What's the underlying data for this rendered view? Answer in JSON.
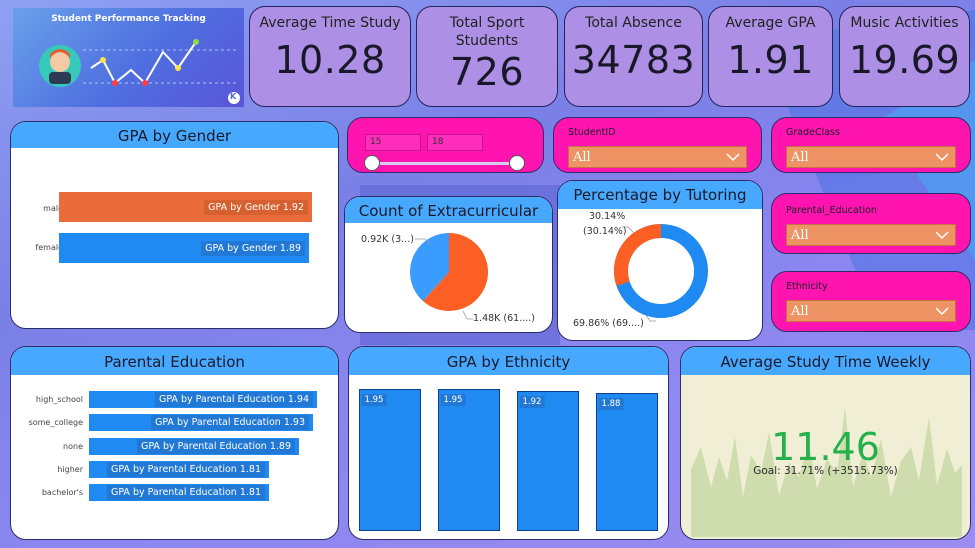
{
  "banner": {
    "title": "Student Performance Tracking",
    "logo_letter": "K"
  },
  "kpis": [
    {
      "label": "Average Time Study",
      "value": "10.28"
    },
    {
      "label": "Total Sport Students",
      "value": "726"
    },
    {
      "label": "Total Absence",
      "value": "34783"
    },
    {
      "label": "Average GPA",
      "value": "1.91"
    },
    {
      "label": "Music Activities",
      "value": "19.69"
    }
  ],
  "gpa_gender": {
    "title": "GPA by Gender",
    "rows": [
      {
        "category": "male",
        "label": "GPA by Gender 1.92",
        "value": 1.92,
        "color": "#ea6c3a"
      },
      {
        "category": "female",
        "label": "GPA by Gender 1.89",
        "value": 1.89,
        "color": "#1f8af2"
      }
    ]
  },
  "age_slider": {
    "min": "15",
    "max": "18"
  },
  "slicers": {
    "studentid": {
      "name": "StudentID",
      "value": "All"
    },
    "gradeclass": {
      "name": "GradeClass",
      "value": "All"
    },
    "parental_education": {
      "name": "Parental_Education",
      "value": "All"
    },
    "ethnicity": {
      "name": "Ethnicity",
      "value": "All"
    }
  },
  "extracurricular": {
    "title": "Count of Extracurricular",
    "label_small": "0.92K (3...)",
    "label_large": "1.48K (61....)"
  },
  "tutoring": {
    "title": "Percentage by Tutoring",
    "label_small_1": "30.14%",
    "label_small_2": "(30.14%)",
    "label_large": "69.86% (69....)"
  },
  "parental_education": {
    "title": "Parental Education",
    "rows": [
      {
        "category": "high_school",
        "label": "GPA by Parental Education 1.94",
        "value": 1.94
      },
      {
        "category": "some_college",
        "label": "GPA by Parental Education 1.93",
        "value": 1.93
      },
      {
        "category": "none",
        "label": "GPA by Parental Education 1.89",
        "value": 1.89
      },
      {
        "category": "higher",
        "label": "GPA by Parental Education 1.81",
        "value": 1.81
      },
      {
        "category": "bachelor's",
        "label": "GPA by Parental Education 1.81",
        "value": 1.81
      }
    ]
  },
  "gpa_ethnicity": {
    "title": "GPA by Ethnicity",
    "bars": [
      {
        "label": "1.95",
        "value": 1.95
      },
      {
        "label": "1.95",
        "value": 1.95
      },
      {
        "label": "1.92",
        "value": 1.92
      },
      {
        "label": "1.88",
        "value": 1.88
      }
    ]
  },
  "study_time": {
    "title": "Average Study Time Weekly",
    "value": "11.46",
    "goal": "Goal: 31.71% (+3515.73%)"
  },
  "chart_data": [
    {
      "type": "bar",
      "title": "GPA by Gender",
      "categories": [
        "male",
        "female"
      ],
      "values": [
        1.92,
        1.89
      ],
      "orientation": "horizontal"
    },
    {
      "type": "pie",
      "title": "Count of Extracurricular",
      "values": [
        920,
        1480
      ],
      "labels": [
        "0.92K (3...)",
        "1.48K (61....)"
      ]
    },
    {
      "type": "pie",
      "title": "Percentage by Tutoring",
      "values": [
        30.14,
        69.86
      ],
      "labels": [
        "30.14% (30.14%)",
        "69.86% (69....)"
      ],
      "donut": true
    },
    {
      "type": "bar",
      "title": "Parental Education",
      "categories": [
        "high_school",
        "some_college",
        "none",
        "higher",
        "bachelor's"
      ],
      "values": [
        1.94,
        1.93,
        1.89,
        1.81,
        1.81
      ],
      "orientation": "horizontal"
    },
    {
      "type": "bar",
      "title": "GPA by Ethnicity",
      "categories": [
        "",
        "",
        "",
        ""
      ],
      "values": [
        1.95,
        1.95,
        1.92,
        1.88
      ]
    },
    {
      "type": "area",
      "title": "Average Study Time Weekly",
      "value": 11.46
    }
  ]
}
